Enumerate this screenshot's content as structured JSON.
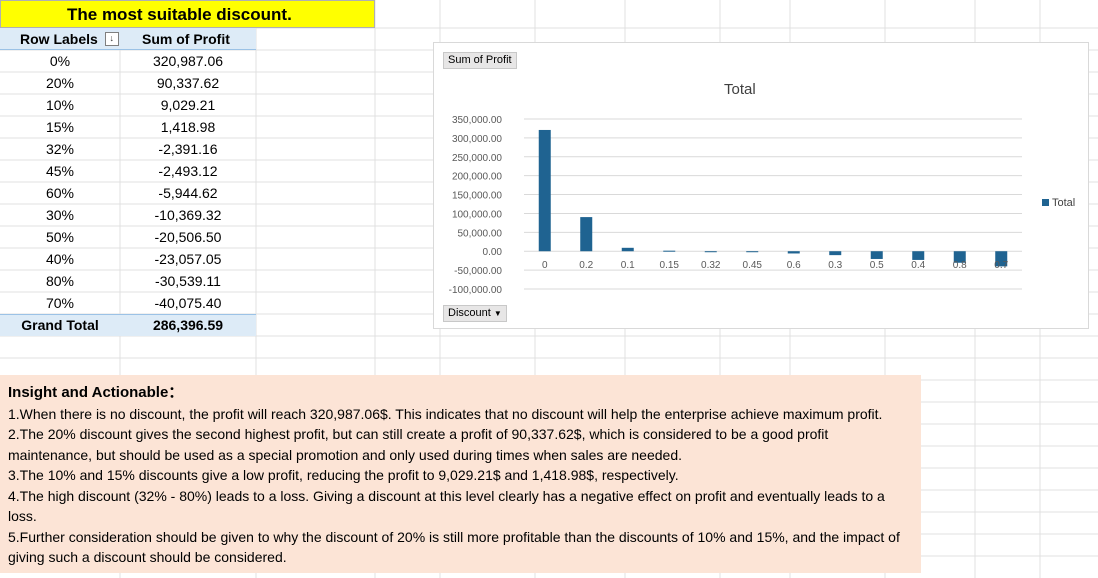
{
  "title": "The most suitable discount.",
  "pivot": {
    "header_row_labels": "Row Labels",
    "header_sum": "Sum of Profit",
    "rows": [
      {
        "label": "0%",
        "value": "320,987.06"
      },
      {
        "label": "20%",
        "value": "90,337.62"
      },
      {
        "label": "10%",
        "value": "9,029.21"
      },
      {
        "label": "15%",
        "value": "1,418.98"
      },
      {
        "label": "32%",
        "value": "-2,391.16"
      },
      {
        "label": "45%",
        "value": "-2,493.12"
      },
      {
        "label": "60%",
        "value": "-5,944.62"
      },
      {
        "label": "30%",
        "value": "-10,369.32"
      },
      {
        "label": "50%",
        "value": "-20,506.50"
      },
      {
        "label": "40%",
        "value": "-23,057.05"
      },
      {
        "label": "80%",
        "value": "-30,539.11"
      },
      {
        "label": "70%",
        "value": "-40,075.40"
      }
    ],
    "grand_total_label": "Grand Total",
    "grand_total_value": "286,396.59"
  },
  "chart_buttons": {
    "value_field": "Sum of Profit",
    "axis_field": "Discount"
  },
  "chart_data": {
    "type": "bar",
    "title": "Total",
    "categories": [
      "0",
      "0.2",
      "0.1",
      "0.15",
      "0.32",
      "0.45",
      "0.6",
      "0.3",
      "0.5",
      "0.4",
      "0.8",
      "0.7"
    ],
    "series": [
      {
        "name": "Total",
        "values": [
          320987.06,
          90337.62,
          9029.21,
          1418.98,
          -2391.16,
          -2493.12,
          -5944.62,
          -10369.32,
          -20506.5,
          -23057.05,
          -30539.11,
          -40075.4
        ],
        "color": "#1f6391"
      }
    ],
    "ylim": [
      -100000,
      350000
    ],
    "yticks": [
      "350,000.00",
      "300,000.00",
      "250,000.00",
      "200,000.00",
      "150,000.00",
      "100,000.00",
      "50,000.00",
      "0.00",
      "-50,000.00",
      "-100,000.00"
    ],
    "grid": true,
    "legend": "right"
  },
  "insight": {
    "heading": "Insight and Actionable：",
    "points": [
      "1.When there is no discount, the profit will reach 320,987.06$. This indicates that no discount will help the enterprise achieve maximum profit.",
      "2.The 20% discount gives the second highest profit, but can still create a profit of 90,337.62$, which is considered to be a good profit maintenance, but should be used as a special promotion and only used during times when sales are needed.",
      "3.The 10% and 15% discounts give a low profit, reducing the profit to 9,029.21$ and 1,418.98$, respectively.",
      "4.The high discount (32% - 80%) leads to a loss. Giving a discount at this level clearly has a negative effect on profit and eventually leads to a loss.",
      "5.Further consideration should be given to why the discount of 20% is still more profitable than the discounts of 10% and 15%, and the impact of giving such a discount should be considered."
    ]
  }
}
